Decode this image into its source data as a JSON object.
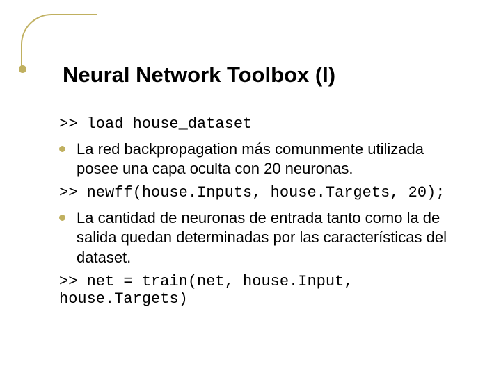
{
  "title": "Neural Network Toolbox (I)",
  "code1": ">> load house_dataset",
  "bullet1": "La red backpropagation más comunmente utilizada posee una capa oculta con 20 neuronas.",
  "code2": ">> newff(house.Inputs, house.Targets, 20);",
  "bullet2": "La cantidad de neuronas de entrada tanto como la de salida quedan determinadas por las características del dataset.",
  "code3": ">> net = train(net, house.Input, house.Targets)"
}
